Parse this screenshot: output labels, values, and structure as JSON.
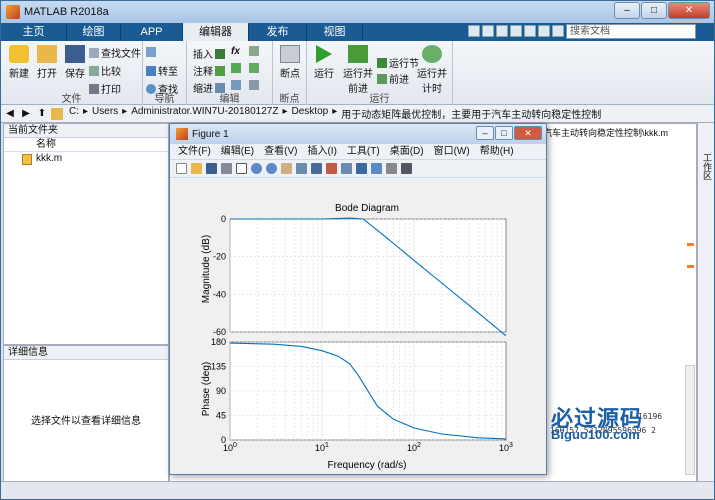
{
  "app": {
    "title": "MATLAB R2018a"
  },
  "tabs": [
    "主页",
    "绘图",
    "APP",
    "编辑器",
    "发布",
    "视图"
  ],
  "search": {
    "placeholder": "搜索文档"
  },
  "ribbon": {
    "file": {
      "label": "文件",
      "new": "新建",
      "open": "打开",
      "save": "保存",
      "find_files": "查找文件",
      "compare": "比较",
      "print": "打印"
    },
    "nav": {
      "label": "导航",
      "goto": "转至",
      "find": "查找"
    },
    "edit": {
      "label": "编辑",
      "insert": "插入",
      "comment": "注释",
      "indent": "缩进",
      "fx": "fx"
    },
    "breakpoints": {
      "label": "断点",
      "breakpoints": "断点"
    },
    "run": {
      "label": "运行",
      "run": "运行",
      "run_advance": "运行并\n前进",
      "run_section": "运行节",
      "advance": "前进",
      "run_time": "运行并\n计时"
    }
  },
  "address": {
    "parts": [
      "C:",
      "Users",
      "Administrator.WIN7U-20180127Z",
      "Desktop",
      "用于动态矩阵最优控制，主要用于汽车主动转向稳定性控制"
    ]
  },
  "current_folder": {
    "title": "当前文件夹",
    "col_name": "名称",
    "files": [
      "kkk.m"
    ]
  },
  "details": {
    "title": "详细信息",
    "placeholder": "选择文件以查看详细信息"
  },
  "editor_tab": "于汽车主动转向稳定性控制\\kkk.m",
  "workspace_label": "工作区",
  "cmd_lines": [
    "16196",
    "160157.5212095596596 2",
    "Biguo100.com"
  ],
  "watermark": {
    "cn": "必过源码",
    "en": "Biguo100.com"
  },
  "figure": {
    "title": "Figure 1",
    "menus": [
      "文件(F)",
      "编辑(E)",
      "查看(V)",
      "插入(I)",
      "工具(T)",
      "桌面(D)",
      "窗口(W)",
      "帮助(H)"
    ]
  },
  "chart_data": {
    "type": "line",
    "title": "Bode Diagram",
    "xlabel": "Frequency  (rad/s)",
    "x_scale": "log",
    "xlim": [
      1,
      1000
    ],
    "x_ticks": [
      "10^0",
      "10^1",
      "10^2",
      "10^3"
    ],
    "grid": true,
    "plots": [
      {
        "ylabel": "Magnitude (dB)",
        "ylim": [
          -60,
          0
        ],
        "y_ticks": [
          0,
          -20,
          -40,
          -60
        ],
        "x": [
          1,
          3,
          10,
          20,
          28,
          40,
          60,
          100,
          200,
          400,
          1000
        ],
        "y": [
          0,
          0,
          0,
          0.5,
          0,
          -6,
          -13,
          -22,
          -34,
          -46,
          -62
        ],
        "color": "#0072bd"
      },
      {
        "ylabel": "Phase (deg)",
        "ylim": [
          0,
          180
        ],
        "y_ticks": [
          180,
          135,
          90,
          45,
          0
        ],
        "x": [
          1,
          3,
          6,
          10,
          15,
          20,
          25,
          30,
          40,
          60,
          100,
          200,
          500,
          1000
        ],
        "y": [
          178,
          176,
          172,
          164,
          154,
          140,
          118,
          96,
          62,
          38,
          22,
          11,
          4,
          2
        ],
        "color": "#0072bd"
      }
    ]
  },
  "colors": {
    "tab_bar": "#1b5b93",
    "plot_line": "#0072bd",
    "accent": "#f08020"
  }
}
